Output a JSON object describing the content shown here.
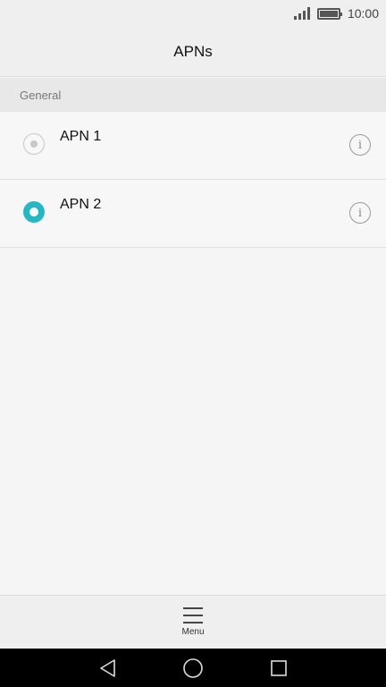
{
  "status_bar": {
    "time": "10:00",
    "icons": [
      "signal-icon",
      "battery-icon"
    ]
  },
  "header": {
    "title": "APNs"
  },
  "section": {
    "label": "General"
  },
  "apns": [
    {
      "label": "APN 1",
      "selected": false,
      "info_icon": "info-icon"
    },
    {
      "label": "APN 2",
      "selected": true,
      "info_icon": "info-icon"
    }
  ],
  "bottom_bar": {
    "menu_label": "Menu",
    "menu_icon": "hamburger-menu-icon"
  },
  "nav_bar": {
    "buttons": [
      "back-icon",
      "home-icon",
      "recents-icon"
    ]
  },
  "colors": {
    "accent": "#26b7c6",
    "background": "#f5f5f5",
    "bar": "#efefef",
    "nav": "#000000"
  }
}
